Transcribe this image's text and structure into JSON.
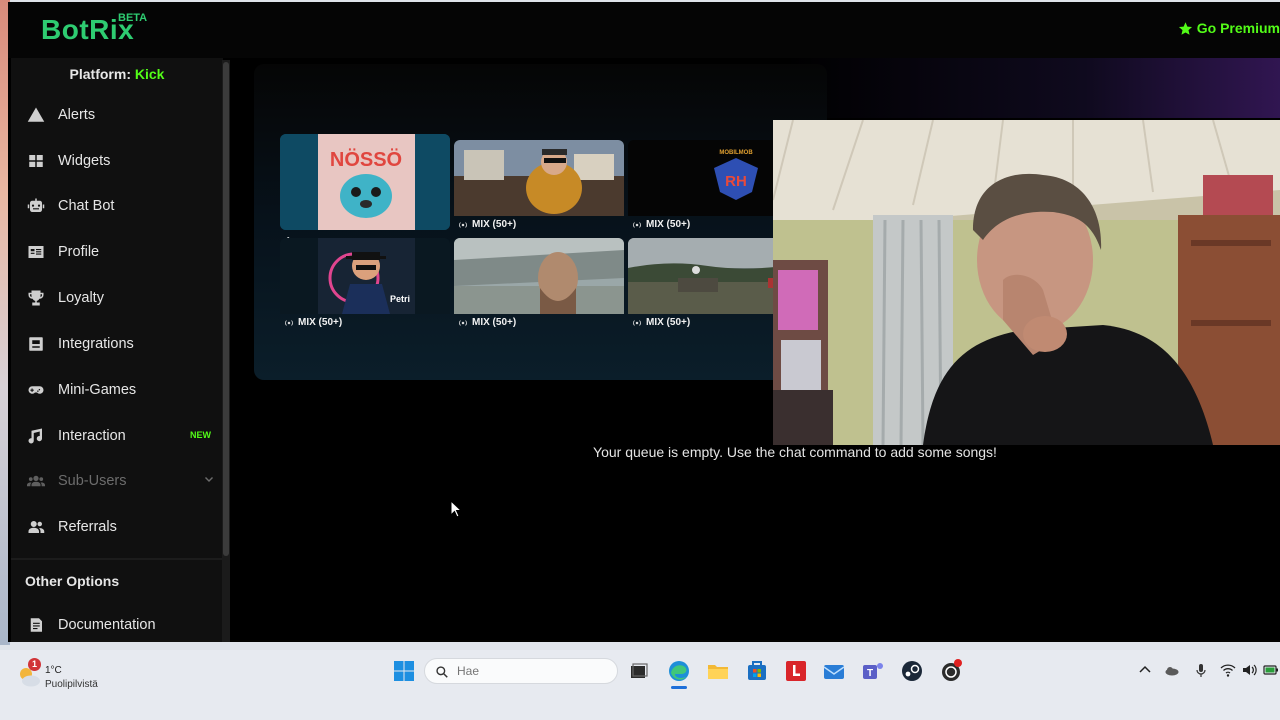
{
  "header": {
    "logo": "BotRix",
    "logo_badge": "BETA",
    "premium_label": "Go Premium",
    "accent_color": "#53fc18",
    "logo_color": "#2ecc71"
  },
  "sidebar": {
    "platform_label": "Platform:",
    "platform_value": "Kick",
    "items": [
      {
        "label": "Alerts",
        "icon": "warning-icon"
      },
      {
        "label": "Widgets",
        "icon": "grid-icon"
      },
      {
        "label": "Chat Bot",
        "icon": "robot-icon"
      },
      {
        "label": "Profile",
        "icon": "id-card-icon"
      },
      {
        "label": "Loyalty",
        "icon": "trophy-icon"
      },
      {
        "label": "Integrations",
        "icon": "integrations-icon"
      },
      {
        "label": "Mini-Games",
        "icon": "gamepad-icon"
      },
      {
        "label": "Interaction",
        "icon": "music-icon",
        "badge": "NEW"
      },
      {
        "label": "Sub-Users",
        "icon": "users-icon",
        "disabled": true
      },
      {
        "label": "Referrals",
        "icon": "user-group-icon"
      }
    ],
    "section_title": "Other Options",
    "extra_items": [
      {
        "label": "Documentation",
        "icon": "document-icon"
      }
    ]
  },
  "player": {
    "tiles": [
      {
        "label": "",
        "active": true
      },
      {
        "label": "MIX (50+)"
      },
      {
        "label": "MIX (50+)"
      },
      {
        "label": "MIX (50+)"
      },
      {
        "label": "MIX (50+)"
      },
      {
        "label": "MIX (50+)"
      }
    ],
    "album_art_text": "NÖSSÖ",
    "album_art_text_2": "Petri\nNygård",
    "album_art_text_3": "RH"
  },
  "queue": {
    "empty_message": "Your queue is empty. Use the chat command to add some songs!"
  },
  "taskbar": {
    "weather_temp": "1°C",
    "weather_desc": "Puolipilvistä",
    "weather_badge": "1",
    "search_placeholder": "Hae"
  }
}
